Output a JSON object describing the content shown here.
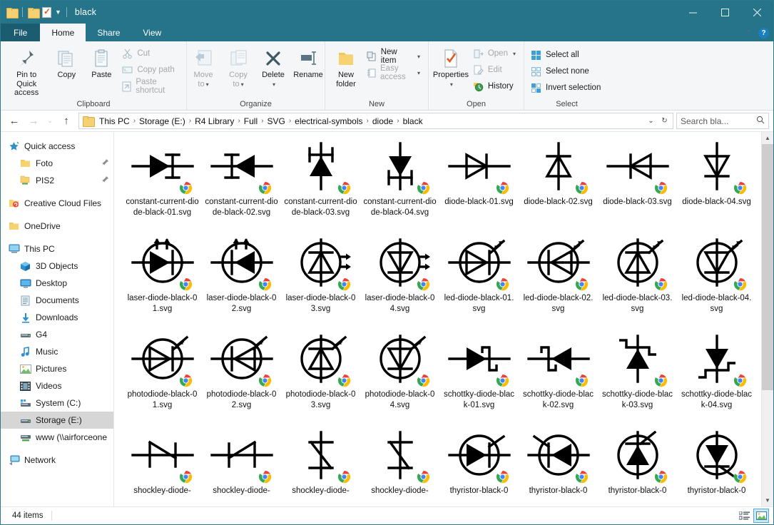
{
  "window": {
    "title": "black",
    "quick_access": [
      "folder-icon",
      "folder-icon",
      "properties-checkmark-icon",
      "customize-chevron-icon"
    ],
    "controls": {
      "minimize": "minimize-icon",
      "maximize": "maximize-icon",
      "close": "close-icon"
    }
  },
  "tabs": [
    {
      "label": "File",
      "active": false
    },
    {
      "label": "Home",
      "active": true
    },
    {
      "label": "Share",
      "active": false
    },
    {
      "label": "View",
      "active": false
    }
  ],
  "ribbon": {
    "collapse_icon": "chevron-up-icon",
    "help_icon": "help-icon",
    "help_label": "?",
    "groups": [
      {
        "label": "Clipboard",
        "big": [
          {
            "label": "Pin to Quick\naccess",
            "line1": "Pin to Quick",
            "line2": "access",
            "icon": "pin-icon",
            "dim": false
          },
          {
            "label": "Copy",
            "line1": "Copy",
            "line2": "",
            "icon": "copy-icon",
            "dim": false
          },
          {
            "label": "Paste",
            "line1": "Paste",
            "line2": "",
            "icon": "paste-icon",
            "dim": false
          }
        ],
        "small": [
          {
            "label": "Cut",
            "icon": "scissors-icon",
            "dim": true
          },
          {
            "label": "Copy path",
            "icon": "copy-path-icon",
            "dim": true
          },
          {
            "label": "Paste shortcut",
            "icon": "paste-shortcut-icon",
            "dim": true
          }
        ]
      },
      {
        "label": "Organize",
        "big": [
          {
            "line1": "Move",
            "line2": "to",
            "icon": "move-to-icon",
            "dim": true,
            "caret": true
          },
          {
            "line1": "Copy",
            "line2": "to",
            "icon": "copy-to-icon",
            "dim": true,
            "caret": true
          },
          {
            "line1": "Delete",
            "line2": "",
            "icon": "delete-x-icon",
            "dim": false,
            "caret": true
          },
          {
            "line1": "Rename",
            "line2": "",
            "icon": "rename-icon",
            "dim": false,
            "caret": false
          }
        ],
        "small": []
      },
      {
        "label": "New",
        "big": [
          {
            "line1": "New",
            "line2": "folder",
            "icon": "new-folder-icon",
            "dim": false
          }
        ],
        "small": [
          {
            "label": "New item",
            "icon": "new-item-icon",
            "dim": false,
            "caret": true
          },
          {
            "label": "Easy access",
            "icon": "easy-access-icon",
            "dim": true,
            "caret": true
          }
        ]
      },
      {
        "label": "Open",
        "big": [
          {
            "line1": "Properties",
            "line2": "",
            "icon": "properties-icon",
            "dim": false,
            "caret": true
          }
        ],
        "small": [
          {
            "label": "Open",
            "icon": "open-icon",
            "dim": true,
            "caret": true
          },
          {
            "label": "Edit",
            "icon": "edit-icon",
            "dim": true
          },
          {
            "label": "History",
            "icon": "history-icon",
            "dim": false
          }
        ]
      },
      {
        "label": "Select",
        "big": [],
        "small": [
          {
            "label": "Select all",
            "icon": "select-all-icon",
            "dim": false
          },
          {
            "label": "Select none",
            "icon": "select-none-icon",
            "dim": false
          },
          {
            "label": "Invert selection",
            "icon": "invert-selection-icon",
            "dim": false
          }
        ]
      }
    ]
  },
  "addressbar": {
    "back_icon": "back-arrow-icon",
    "forward_icon": "forward-arrow-icon",
    "recent_icon": "recent-chevron-icon",
    "up_icon": "up-arrow-icon",
    "breadcrumbs": [
      "This PC",
      "Storage (E:)",
      "R4 Library",
      "Full",
      "SVG",
      "electrical-symbols",
      "diode",
      "black"
    ],
    "dropdown_icon": "chevron-down-icon",
    "refresh_icon": "refresh-icon",
    "search_placeholder": "Search bla...",
    "search_icon": "search-icon"
  },
  "sidebar": {
    "items": [
      {
        "label": "Quick access",
        "icon": "star-icon",
        "indent": 0,
        "pinned": false,
        "selected": false,
        "gap_before": false
      },
      {
        "label": "Foto",
        "icon": "folder-icon",
        "indent": 1,
        "pinned": true,
        "selected": false,
        "gap_before": false
      },
      {
        "label": "PIS2",
        "icon": "folder-network-icon",
        "indent": 1,
        "pinned": true,
        "selected": false,
        "gap_before": false
      },
      {
        "label": "Creative Cloud Files",
        "icon": "creative-cloud-icon",
        "indent": 0,
        "pinned": false,
        "selected": false,
        "gap_before": true
      },
      {
        "label": "OneDrive",
        "icon": "onedrive-folder-icon",
        "indent": 0,
        "pinned": false,
        "selected": false,
        "gap_before": true
      },
      {
        "label": "This PC",
        "icon": "this-pc-icon",
        "indent": 0,
        "pinned": false,
        "selected": false,
        "gap_before": true
      },
      {
        "label": "3D Objects",
        "icon": "3d-objects-icon",
        "indent": 1,
        "pinned": false,
        "selected": false,
        "gap_before": false
      },
      {
        "label": "Desktop",
        "icon": "desktop-icon",
        "indent": 1,
        "pinned": false,
        "selected": false,
        "gap_before": false
      },
      {
        "label": "Documents",
        "icon": "documents-icon",
        "indent": 1,
        "pinned": false,
        "selected": false,
        "gap_before": false
      },
      {
        "label": "Downloads",
        "icon": "downloads-icon",
        "indent": 1,
        "pinned": false,
        "selected": false,
        "gap_before": false
      },
      {
        "label": "G4",
        "icon": "drive-icon",
        "indent": 1,
        "pinned": false,
        "selected": false,
        "gap_before": false
      },
      {
        "label": "Music",
        "icon": "music-icon",
        "indent": 1,
        "pinned": false,
        "selected": false,
        "gap_before": false
      },
      {
        "label": "Pictures",
        "icon": "pictures-icon",
        "indent": 1,
        "pinned": false,
        "selected": false,
        "gap_before": false
      },
      {
        "label": "Videos",
        "icon": "videos-icon",
        "indent": 1,
        "pinned": false,
        "selected": false,
        "gap_before": false
      },
      {
        "label": "System (C:)",
        "icon": "system-drive-icon",
        "indent": 1,
        "pinned": false,
        "selected": false,
        "gap_before": false
      },
      {
        "label": "Storage (E:)",
        "icon": "drive-icon",
        "indent": 1,
        "pinned": false,
        "selected": true,
        "gap_before": false
      },
      {
        "label": "www (\\\\airforceone",
        "icon": "network-drive-icon",
        "indent": 1,
        "pinned": false,
        "selected": false,
        "gap_before": false
      },
      {
        "label": "Network",
        "icon": "network-icon",
        "indent": 0,
        "pinned": false,
        "selected": false,
        "gap_before": true
      }
    ]
  },
  "files": [
    {
      "name": "constant-current-diode-black-01.svg",
      "symbol": "cc-right-filled"
    },
    {
      "name": "constant-current-diode-black-02.svg",
      "symbol": "cc-left-filled"
    },
    {
      "name": "constant-current-diode-black-03.svg",
      "symbol": "cc-up-filled"
    },
    {
      "name": "constant-current-diode-black-04.svg",
      "symbol": "cc-down-filled"
    },
    {
      "name": "diode-black-01.svg",
      "symbol": "diode-right-outline"
    },
    {
      "name": "diode-black-02.svg",
      "symbol": "diode-up-outline"
    },
    {
      "name": "diode-black-03.svg",
      "symbol": "diode-left-outline"
    },
    {
      "name": "diode-black-04.svg",
      "symbol": "diode-down-outline"
    },
    {
      "name": "laser-diode-black-01.svg",
      "symbol": "laser-right"
    },
    {
      "name": "laser-diode-black-02.svg",
      "symbol": "laser-left"
    },
    {
      "name": "laser-diode-black-03.svg",
      "symbol": "laser-up"
    },
    {
      "name": "laser-diode-black-04.svg",
      "symbol": "laser-down"
    },
    {
      "name": "led-diode-black-01.svg",
      "symbol": "led-right"
    },
    {
      "name": "led-diode-black-02.svg",
      "symbol": "led-left"
    },
    {
      "name": "led-diode-black-03.svg",
      "symbol": "led-up"
    },
    {
      "name": "led-diode-black-04.svg",
      "symbol": "led-down"
    },
    {
      "name": "photodiode-black-01.svg",
      "symbol": "photo-right"
    },
    {
      "name": "photodiode-black-02.svg",
      "symbol": "photo-left"
    },
    {
      "name": "photodiode-black-03.svg",
      "symbol": "photo-up"
    },
    {
      "name": "photodiode-black-04.svg",
      "symbol": "photo-down"
    },
    {
      "name": "schottky-diode-black-01.svg",
      "symbol": "schottky-right"
    },
    {
      "name": "schottky-diode-black-02.svg",
      "symbol": "schottky-left"
    },
    {
      "name": "schottky-diode-black-03.svg",
      "symbol": "schottky-up"
    },
    {
      "name": "schottky-diode-black-04.svg",
      "symbol": "schottky-down"
    },
    {
      "name": "shockley-diode-",
      "symbol": "shockley-right"
    },
    {
      "name": "shockley-diode-",
      "symbol": "shockley-left"
    },
    {
      "name": "shockley-diode-",
      "symbol": "shockley-up"
    },
    {
      "name": "shockley-diode-",
      "symbol": "shockley-down"
    },
    {
      "name": "thyristor-black-0",
      "symbol": "thyristor-right"
    },
    {
      "name": "thyristor-black-0",
      "symbol": "thyristor-left"
    },
    {
      "name": "thyristor-black-0",
      "symbol": "thyristor-up"
    },
    {
      "name": "thyristor-black-0",
      "symbol": "thyristor-down"
    }
  ],
  "statusbar": {
    "item_count": "44 items",
    "details_view_icon": "details-view-icon",
    "large_icons_view_icon": "large-icons-view-icon"
  },
  "colors": {
    "titlebar": "#25748a",
    "ribbon_bg": "#f4f6f7",
    "accent": "#1a7fc1",
    "selection": "#d6d6d6",
    "folder_yellow": "#f5d173"
  }
}
